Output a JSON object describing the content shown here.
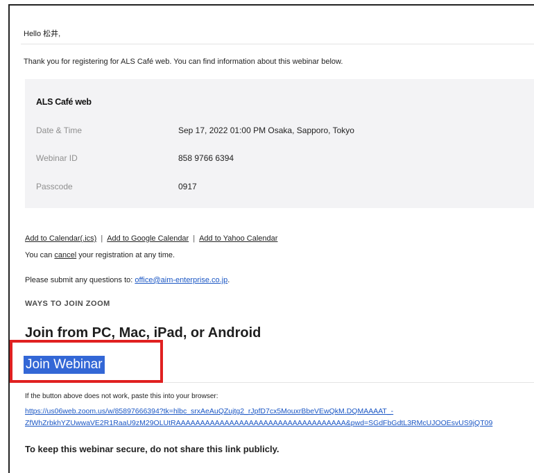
{
  "greeting": "Hello 松井,",
  "intro": "Thank you for registering for ALS Café web. You can find information about this webinar below.",
  "webinar": {
    "title": "ALS Café web",
    "rows": [
      {
        "label": "Date & Time",
        "value": "Sep 17, 2022 01:00 PM Osaka, Sapporo, Tokyo"
      },
      {
        "label": "Webinar ID",
        "value": "858 9766 6394"
      },
      {
        "label": "Passcode",
        "value": "0917"
      }
    ]
  },
  "calendar_links": {
    "ics": "Add to Calendar(.ics)",
    "google": "Add to Google Calendar",
    "yahoo": "Add to Yahoo Calendar",
    "separator": "|"
  },
  "cancel_line": {
    "prefix": "You can ",
    "link": "cancel",
    "suffix": " your registration at any time."
  },
  "questions_line": {
    "prefix": "Please submit any questions to: ",
    "email": "office@aim-enterprise.co.jp",
    "suffix": "."
  },
  "ways_heading": "WAYS TO JOIN ZOOM",
  "join_heading": "Join from PC, Mac, iPad, or Android",
  "join_button": "Join Webinar",
  "fallback_text": "If the button above does not work, paste this into your browser:",
  "url_line1": "https://us06web.zoom.us/w/85897666394?tk=hlbc_srxAeAuQZujtg2_rJpfD7cx5MouxrBbeVEwQkM.DQMAAAAT_-",
  "url_line2": "ZfWhZrbkhYZUwwaVE2R1RaaU9zM29OLUtRAAAAAAAAAAAAAAAAAAAAAAAAAAAAAAAAAAA&pwd=SGdFbGdtL3RMcUJOOEsvUS9jQT09",
  "secure_note": "To keep this webinar secure, do not share this link publicly.",
  "colors": {
    "button_bg": "#3367d6",
    "highlight_border": "#e02020",
    "link_blue": "#1a56c4"
  }
}
